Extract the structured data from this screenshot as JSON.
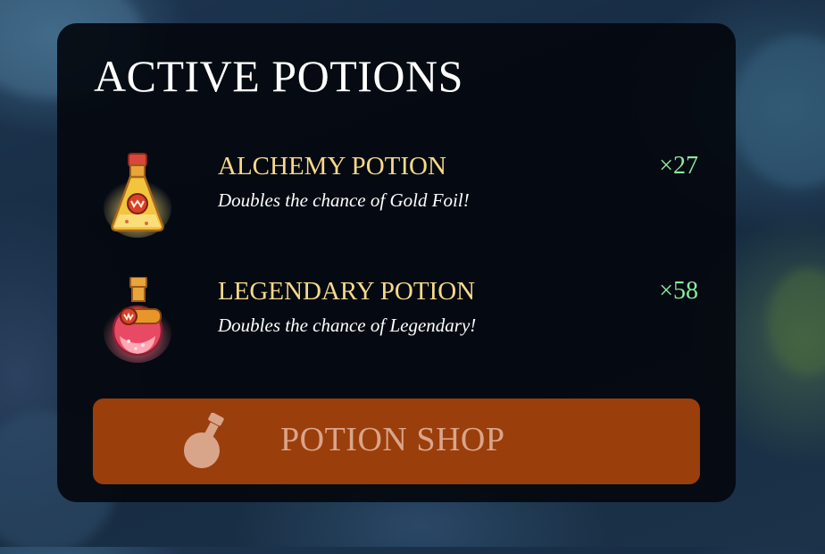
{
  "panel": {
    "title": "ACTIVE POTIONS"
  },
  "potions": [
    {
      "name": "ALCHEMY POTION",
      "description": "Doubles the chance of Gold Foil!",
      "count": "×27",
      "icon": "alchemy-potion-icon"
    },
    {
      "name": "LEGENDARY POTION",
      "description": "Doubles the chance of Legendary!",
      "count": "×58",
      "icon": "legendary-potion-icon"
    }
  ],
  "shop_button": {
    "label": "POTION SHOP",
    "icon": "potion-flask-icon"
  },
  "colors": {
    "title": "#ffffff",
    "potion_name": "#f6d98a",
    "count": "#8ee89e",
    "button_bg": "#9a3e0c",
    "button_text": "#d9a58a"
  }
}
